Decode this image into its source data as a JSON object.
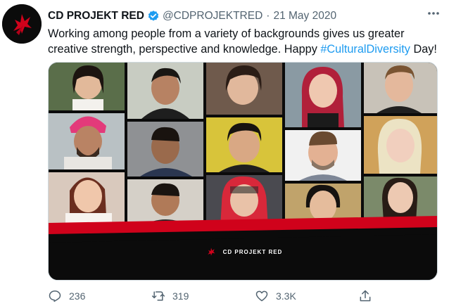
{
  "tweet": {
    "author": "CD PROJEKT RED",
    "handle": "@CDPROJEKTRED",
    "separator": "·",
    "date": "21 May 2020",
    "text_line1": "Working among people from a variety of backgrounds gives us greater",
    "text_line2_before": "creative strength, perspective and knowledge. Happy ",
    "hashtag": "#CulturalDiversity",
    "text_line2_after": " Day!"
  },
  "media": {
    "brand_label": "CD PROJEKT RED",
    "brand_mark": "®"
  },
  "actions": {
    "reply_count": "236",
    "retweet_count": "319",
    "like_count": "3.3K"
  },
  "icons": {
    "avatar": "cdpr-logo-icon",
    "verified": "verified-badge-icon",
    "more": "more-options-icon",
    "reply": "reply-icon",
    "retweet": "retweet-icon",
    "like": "like-icon",
    "share": "share-icon"
  },
  "colors": {
    "accent": "#1d9bf0",
    "brand_red": "#d0021b",
    "muted": "#536471"
  }
}
